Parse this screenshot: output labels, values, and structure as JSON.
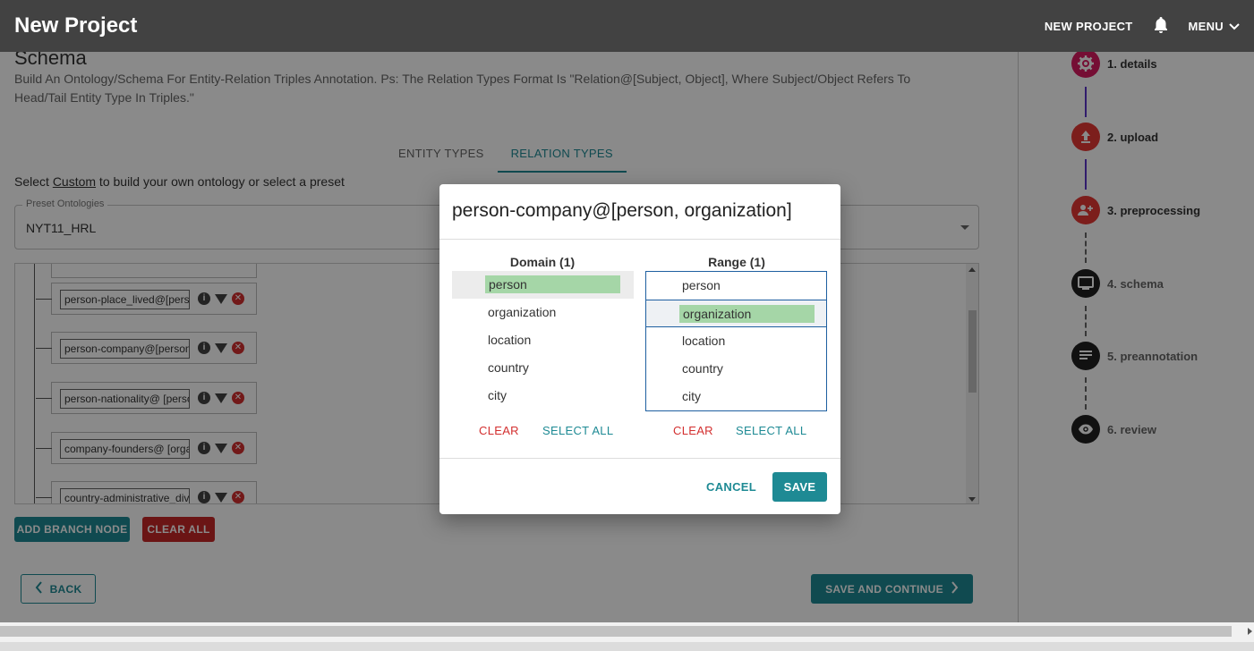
{
  "header": {
    "title": "New Project",
    "new_project": "NEW PROJECT",
    "menu": "MENU"
  },
  "schema": {
    "title": "Schema",
    "description": "Build An Ontology/Schema For Entity-Relation Triples Annotation. Ps: The Relation Types Format Is \"Relation@[Subject, Object], Where Subject/Object Refers To Head/Tail Entity Type In Triples.\"",
    "tabs": [
      {
        "label": "ENTITY TYPES"
      },
      {
        "label": "RELATION TYPES"
      }
    ],
    "hint_prefix": "Select ",
    "hint_link": "Custom",
    "hint_suffix": " to build your own ontology or select a preset",
    "preset_label": "Preset Ontologies",
    "preset_value": "NYT11_HRL",
    "nodes": [
      {
        "value": "person-place_lived@[person, location]"
      },
      {
        "value": "person-company@[person, organization]"
      },
      {
        "value": "person-nationality@ [person, country]"
      },
      {
        "value": "company-founders@ [organization, person]"
      },
      {
        "value": "country-administrative_divisions"
      }
    ],
    "add_branch": "ADD BRANCH NODE",
    "clear_all": "CLEAR ALL",
    "back": "BACK",
    "save_continue": "SAVE AND CONTINUE"
  },
  "stepper": {
    "steps": [
      {
        "label": "1. details",
        "color": "#d81b60"
      },
      {
        "label": "2. upload",
        "color": "#e53935"
      },
      {
        "label": "3. preprocessing",
        "color": "#e53935"
      },
      {
        "label": "4. schema",
        "color": "#212121"
      },
      {
        "label": "5. preannotation",
        "color": "#212121"
      },
      {
        "label": "6. review",
        "color": "#212121"
      }
    ]
  },
  "dialog": {
    "title": "person-company@[person, organization]",
    "domain": {
      "header": "Domain (1)",
      "items": [
        "person",
        "organization",
        "location",
        "country",
        "city"
      ],
      "selected": "person"
    },
    "range": {
      "header": "Range (1)",
      "items": [
        "person",
        "organization",
        "location",
        "country",
        "city"
      ],
      "selected": "organization"
    },
    "clear": "CLEAR",
    "select_all": "SELECT ALL",
    "cancel": "CANCEL",
    "save": "SAVE"
  }
}
